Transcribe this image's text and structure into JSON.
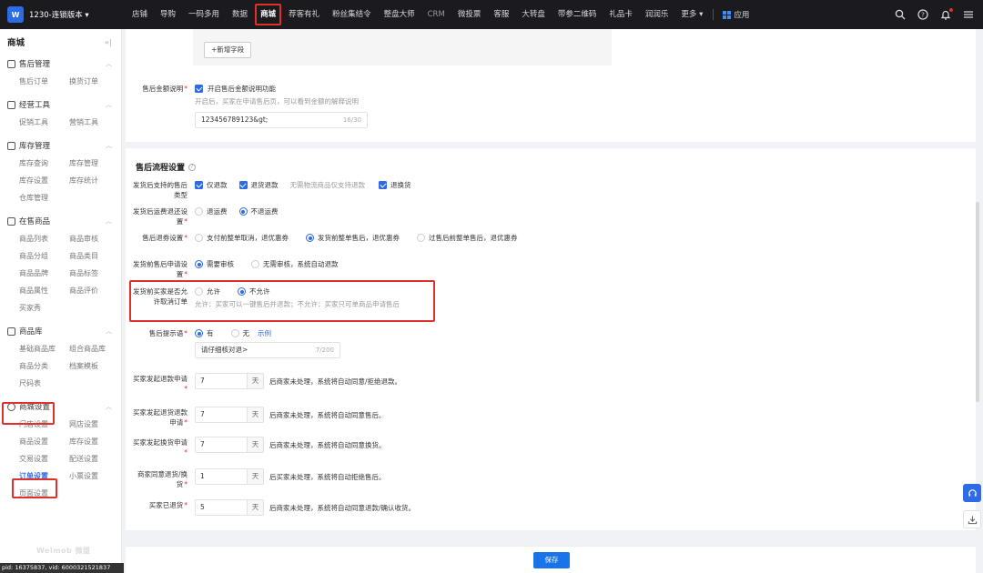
{
  "topbar": {
    "brand": "1230-连锁版本 ▾",
    "nav": [
      "店铺",
      "导购",
      "一码多用",
      "数据",
      "商城",
      "荐客有礼",
      "粉丝集结令",
      "整盘大师",
      "CRM",
      "微投票",
      "客服",
      "大转盘",
      "带参二维码",
      "礼品卡",
      "润润乐",
      "更多 ▾"
    ],
    "active_nav": "商城",
    "app": "应用"
  },
  "sidebar": {
    "title": "商城",
    "groups": [
      {
        "label": "售后管理",
        "items": [
          "售后订单",
          "换货订单"
        ]
      },
      {
        "label": "经营工具",
        "items": [
          "促销工具",
          "营销工具"
        ]
      },
      {
        "label": "库存管理",
        "items": [
          "库存查询",
          "库存管理",
          "库存设置",
          "库存统计",
          "仓库管理"
        ]
      },
      {
        "label": "在售商品",
        "items": [
          "商品列表",
          "商品审核",
          "商品分组",
          "商品类目",
          "商品品牌",
          "商品标签",
          "商品属性",
          "商品评价",
          "买家秀"
        ]
      },
      {
        "label": "商品库",
        "items": [
          "基础商品库",
          "组合商品库",
          "商品分类",
          "档案模板",
          "尺码表"
        ]
      },
      {
        "label": "商城设置",
        "items": [
          "门店设置",
          "网店设置",
          "商品设置",
          "库存设置",
          "交易设置",
          "配送设置",
          "订单设置",
          "小票设置",
          "页面设置"
        ]
      }
    ],
    "active_item": "订单设置",
    "watermark": "Weimob 微盟",
    "pid": "pid: 16375837, vid: 6000321521837"
  },
  "card1": {
    "add_field": "+新增字段",
    "amount_label": "售后金额说明",
    "amount_check": "开启售后金额说明功能",
    "amount_hint": "开启后，买家在申请售后页，可以看到金额的解释说明",
    "amount_value": "123456789123&gt;",
    "amount_count": "16/30"
  },
  "flow": {
    "title": "售后流程设置",
    "types_label": "发货后支持的售后类型",
    "types": [
      "仅退款",
      "退货退款",
      "退换货"
    ],
    "types_hint": "无需物流商品仅支持退款",
    "freight_label": "发货后运费退还设置",
    "freight_opts": [
      "退运费",
      "不退运费"
    ],
    "coupon_label": "售后退券设置",
    "coupon_opts": [
      "支付前整单取消，退优惠券",
      "发货前整单售后，退优惠券",
      "过售后前整单售后，退优惠券"
    ],
    "review_label": "发货前售后申请设置",
    "review_opts": [
      "需要审核",
      "无需审核，系统自动退款"
    ],
    "cancel_label": "发货前买家是否允许取消订单",
    "cancel_opts": [
      "允许",
      "不允许"
    ],
    "cancel_hint": "允许：买家可以一键售后并退款；不允许：买家只可单商品申请售后",
    "tip_label": "售后提示语",
    "tip_opts": [
      "有",
      "无"
    ],
    "tip_link": "示例",
    "tip_value": "请仔细核对退>",
    "tip_count": "7/200",
    "unit": "天",
    "timers": [
      {
        "label": "买家发起退款申请",
        "value": "7",
        "desc": "后商家未处理，系统将自动同意/拒绝退款。"
      },
      {
        "label": "买家发起退货退款申请",
        "value": "7",
        "desc": "后商家未处理，系统将自动同意售后。"
      },
      {
        "label": "买家发起换货申请",
        "value": "7",
        "desc": "后商家未处理，系统将自动同意换货。"
      },
      {
        "label": "商家同意退货/换货",
        "value": "1",
        "desc": "后买家未处理，系统将自动拒绝售后。"
      },
      {
        "label": "买家已退货",
        "value": "5",
        "desc": "后商家未处理，系统将自动同意退款/确认收货。"
      }
    ]
  },
  "footer": {
    "save": "保存"
  },
  "colors": {
    "accent": "#2e6be6",
    "highlight": "#e0302b",
    "topbar": "#1b1b1f"
  }
}
